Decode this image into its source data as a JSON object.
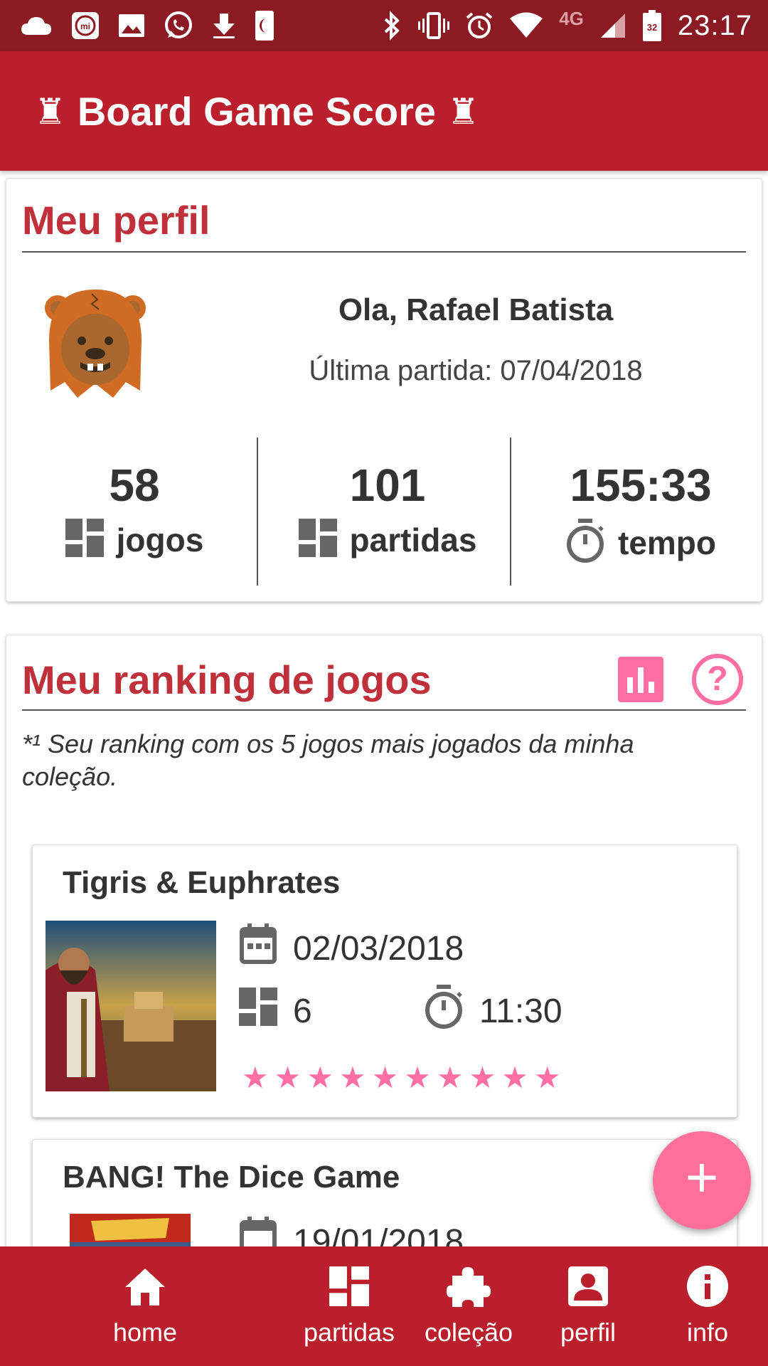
{
  "status_bar": {
    "time": "23:17",
    "network": "4G",
    "battery": "32"
  },
  "app_bar": {
    "title": "Board Game Score"
  },
  "profile": {
    "section_title": "Meu perfil",
    "greeting": "Ola, Rafael Batista",
    "last_match": "Última partida: 07/04/2018",
    "stats": [
      {
        "value": "58",
        "label": "jogos",
        "icon": "dashboard-icon"
      },
      {
        "value": "101",
        "label": "partidas",
        "icon": "dashboard-icon"
      },
      {
        "value": "155:33",
        "label": "tempo",
        "icon": "timer-icon"
      }
    ]
  },
  "ranking": {
    "section_title": "Meu ranking de jogos",
    "note": "*¹ Seu ranking com os 5 jogos mais jogados da minha coleção.",
    "games": [
      {
        "title": "Tigris & Euphrates",
        "date": "02/03/2018",
        "matches": "6",
        "time": "11:30",
        "rating": 10,
        "max_rating": 10
      },
      {
        "title": "BANG! The Dice Game",
        "date": "19/01/2018"
      }
    ]
  },
  "fab": {
    "label": "+"
  },
  "bottom_nav": {
    "items": [
      {
        "label": "home",
        "icon": "home-icon"
      },
      {
        "label": "partidas",
        "icon": "dashboard-icon"
      },
      {
        "label": "coleção",
        "icon": "puzzle-icon"
      },
      {
        "label": "perfil",
        "icon": "account-box-icon"
      },
      {
        "label": "info",
        "icon": "info-icon"
      }
    ]
  },
  "colors": {
    "primary": "#bb1f2b",
    "status_bar": "#8c1a22",
    "accent": "#ff6fa3",
    "title_red": "#c0303a"
  }
}
